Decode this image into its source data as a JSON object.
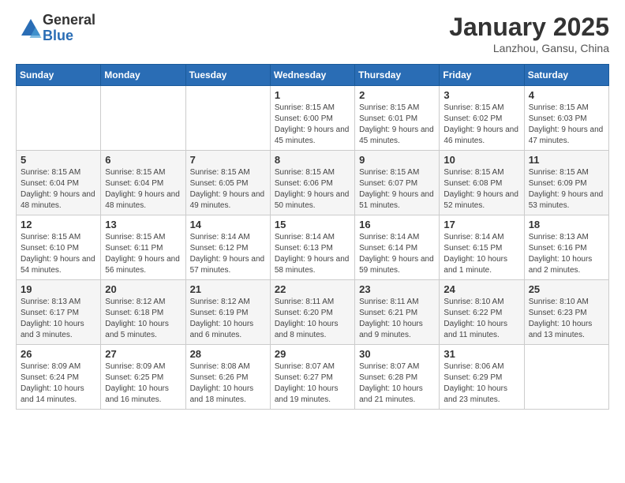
{
  "logo": {
    "general": "General",
    "blue": "Blue"
  },
  "title": "January 2025",
  "location": "Lanzhou, Gansu, China",
  "days_of_week": [
    "Sunday",
    "Monday",
    "Tuesday",
    "Wednesday",
    "Thursday",
    "Friday",
    "Saturday"
  ],
  "weeks": [
    [
      {
        "day": "",
        "info": ""
      },
      {
        "day": "",
        "info": ""
      },
      {
        "day": "",
        "info": ""
      },
      {
        "day": "1",
        "info": "Sunrise: 8:15 AM\nSunset: 6:00 PM\nDaylight: 9 hours and 45 minutes."
      },
      {
        "day": "2",
        "info": "Sunrise: 8:15 AM\nSunset: 6:01 PM\nDaylight: 9 hours and 45 minutes."
      },
      {
        "day": "3",
        "info": "Sunrise: 8:15 AM\nSunset: 6:02 PM\nDaylight: 9 hours and 46 minutes."
      },
      {
        "day": "4",
        "info": "Sunrise: 8:15 AM\nSunset: 6:03 PM\nDaylight: 9 hours and 47 minutes."
      }
    ],
    [
      {
        "day": "5",
        "info": "Sunrise: 8:15 AM\nSunset: 6:04 PM\nDaylight: 9 hours and 48 minutes."
      },
      {
        "day": "6",
        "info": "Sunrise: 8:15 AM\nSunset: 6:04 PM\nDaylight: 9 hours and 48 minutes."
      },
      {
        "day": "7",
        "info": "Sunrise: 8:15 AM\nSunset: 6:05 PM\nDaylight: 9 hours and 49 minutes."
      },
      {
        "day": "8",
        "info": "Sunrise: 8:15 AM\nSunset: 6:06 PM\nDaylight: 9 hours and 50 minutes."
      },
      {
        "day": "9",
        "info": "Sunrise: 8:15 AM\nSunset: 6:07 PM\nDaylight: 9 hours and 51 minutes."
      },
      {
        "day": "10",
        "info": "Sunrise: 8:15 AM\nSunset: 6:08 PM\nDaylight: 9 hours and 52 minutes."
      },
      {
        "day": "11",
        "info": "Sunrise: 8:15 AM\nSunset: 6:09 PM\nDaylight: 9 hours and 53 minutes."
      }
    ],
    [
      {
        "day": "12",
        "info": "Sunrise: 8:15 AM\nSunset: 6:10 PM\nDaylight: 9 hours and 54 minutes."
      },
      {
        "day": "13",
        "info": "Sunrise: 8:15 AM\nSunset: 6:11 PM\nDaylight: 9 hours and 56 minutes."
      },
      {
        "day": "14",
        "info": "Sunrise: 8:14 AM\nSunset: 6:12 PM\nDaylight: 9 hours and 57 minutes."
      },
      {
        "day": "15",
        "info": "Sunrise: 8:14 AM\nSunset: 6:13 PM\nDaylight: 9 hours and 58 minutes."
      },
      {
        "day": "16",
        "info": "Sunrise: 8:14 AM\nSunset: 6:14 PM\nDaylight: 9 hours and 59 minutes."
      },
      {
        "day": "17",
        "info": "Sunrise: 8:14 AM\nSunset: 6:15 PM\nDaylight: 10 hours and 1 minute."
      },
      {
        "day": "18",
        "info": "Sunrise: 8:13 AM\nSunset: 6:16 PM\nDaylight: 10 hours and 2 minutes."
      }
    ],
    [
      {
        "day": "19",
        "info": "Sunrise: 8:13 AM\nSunset: 6:17 PM\nDaylight: 10 hours and 3 minutes."
      },
      {
        "day": "20",
        "info": "Sunrise: 8:12 AM\nSunset: 6:18 PM\nDaylight: 10 hours and 5 minutes."
      },
      {
        "day": "21",
        "info": "Sunrise: 8:12 AM\nSunset: 6:19 PM\nDaylight: 10 hours and 6 minutes."
      },
      {
        "day": "22",
        "info": "Sunrise: 8:11 AM\nSunset: 6:20 PM\nDaylight: 10 hours and 8 minutes."
      },
      {
        "day": "23",
        "info": "Sunrise: 8:11 AM\nSunset: 6:21 PM\nDaylight: 10 hours and 9 minutes."
      },
      {
        "day": "24",
        "info": "Sunrise: 8:10 AM\nSunset: 6:22 PM\nDaylight: 10 hours and 11 minutes."
      },
      {
        "day": "25",
        "info": "Sunrise: 8:10 AM\nSunset: 6:23 PM\nDaylight: 10 hours and 13 minutes."
      }
    ],
    [
      {
        "day": "26",
        "info": "Sunrise: 8:09 AM\nSunset: 6:24 PM\nDaylight: 10 hours and 14 minutes."
      },
      {
        "day": "27",
        "info": "Sunrise: 8:09 AM\nSunset: 6:25 PM\nDaylight: 10 hours and 16 minutes."
      },
      {
        "day": "28",
        "info": "Sunrise: 8:08 AM\nSunset: 6:26 PM\nDaylight: 10 hours and 18 minutes."
      },
      {
        "day": "29",
        "info": "Sunrise: 8:07 AM\nSunset: 6:27 PM\nDaylight: 10 hours and 19 minutes."
      },
      {
        "day": "30",
        "info": "Sunrise: 8:07 AM\nSunset: 6:28 PM\nDaylight: 10 hours and 21 minutes."
      },
      {
        "day": "31",
        "info": "Sunrise: 8:06 AM\nSunset: 6:29 PM\nDaylight: 10 hours and 23 minutes."
      },
      {
        "day": "",
        "info": ""
      }
    ]
  ]
}
